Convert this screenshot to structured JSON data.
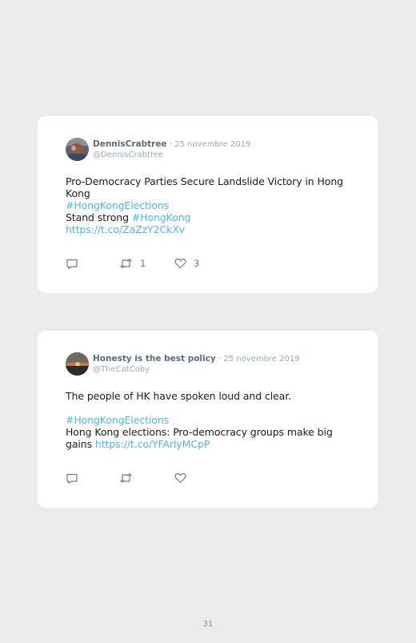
{
  "tweets": [
    {
      "display_name": "DennisCrabtree",
      "date": "· 25 novembre 2019",
      "handle": "@DennisCrabtree",
      "lines": [
        {
          "text": "Pro-Democracy Parties Secure Landslide Victory in Hong"
        },
        {
          "text": "Kong"
        },
        {
          "link": "#HongKongElections"
        },
        {
          "text": "Stand strong ",
          "link": "#HongKong"
        },
        {
          "link": "https://t.co/ZaZzY2CkXv"
        }
      ],
      "retweets": "1",
      "likes": "3"
    },
    {
      "display_name": "Honesty is the best policy",
      "date": "· 25 novembre 2019",
      "handle": "@TheCatCoby",
      "lines": [
        {
          "text": "The people of HK have spoken loud and clear."
        },
        {
          "text": ""
        },
        {
          "link": "#HongKongElections"
        },
        {
          "text": "Hong Kong elections: Pro-democracy groups make big"
        },
        {
          "text": "gains ",
          "link": "https://t.co/YFArlyMCpP"
        }
      ],
      "retweets": "",
      "likes": ""
    }
  ],
  "icons": {
    "reply": "reply-icon",
    "retweet": "retweet-icon",
    "like": "heart-icon"
  },
  "colors": {
    "background": "#ebebeb",
    "card": "#ffffff",
    "link": "#4fb3e8",
    "name": "#5a6b7b",
    "muted": "#9aa8b4"
  },
  "page_number": "31"
}
